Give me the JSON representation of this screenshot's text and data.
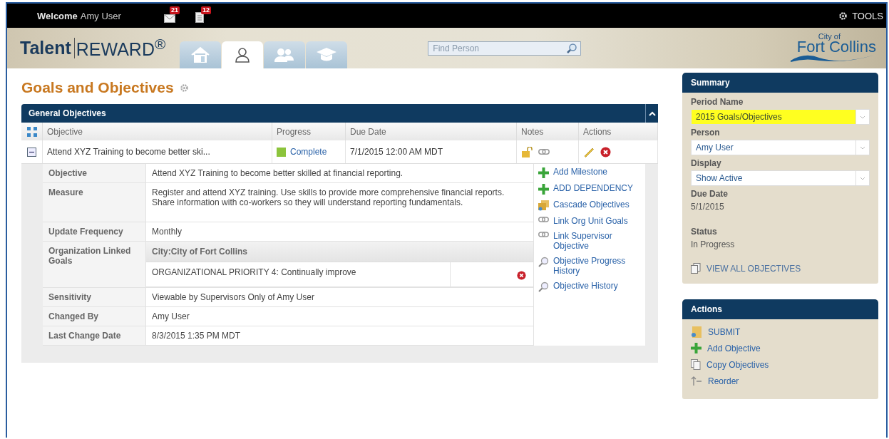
{
  "top_bar": {
    "welcome": "Welcome",
    "user_name": "Amy User",
    "notifications": [
      {
        "kind": "mail",
        "count": "21"
      },
      {
        "kind": "document",
        "count": "12"
      }
    ],
    "tools": "TOOLS"
  },
  "header": {
    "logo_left": "Talent",
    "logo_right": "REWARD$^{®}$",
    "tabs": [
      {
        "kind": "home",
        "selected": false
      },
      {
        "kind": "person",
        "selected": true
      },
      {
        "kind": "group",
        "selected": false
      },
      {
        "kind": "learning",
        "selected": false
      }
    ],
    "search": {
      "placeholder": "Find Person"
    },
    "city_logo_small": "City of",
    "city_logo_large": "Fort Collins"
  },
  "page_title": "Goals and Objectives",
  "objectives_panel": {
    "title": "General Objectives",
    "columns": [
      "Objective",
      "Progress",
      "Due Date",
      "Notes",
      "Actions"
    ],
    "rows": [
      {
        "objective": "Attend XYZ Training to become better ski...",
        "progress": {
          "label": "Complete",
          "color": "#8cc43c"
        },
        "due_date": "7/1/2015 12:00 AM MDT",
        "expanded": true,
        "details": [
          {
            "kind": "text",
            "label": "Objective",
            "value": "Attend XYZ Training to become better skilled at financial reporting."
          },
          {
            "kind": "text",
            "label": "Measure",
            "value": "Register and attend XYZ training.  Use skills to provide more comprehensive financial reports.  Share information with co-workers so they will understand reporting fundamentals."
          },
          {
            "kind": "text",
            "label": "Update Frequency",
            "value": "Monthly"
          },
          {
            "kind": "linked",
            "label": "Organization Linked Goals",
            "group": "City:City of Fort Collins",
            "goal": "ORGANIZATIONAL PRIORITY 4: Continually improve"
          },
          {
            "kind": "text",
            "label": "Sensitivity",
            "value": "Viewable by Supervisors Only of Amy User"
          },
          {
            "kind": "text",
            "label": "Changed By",
            "value": "Amy User"
          },
          {
            "kind": "text",
            "label": "Last Change Date",
            "value": "8/3/2015 1:35 PM MDT"
          }
        ],
        "links": [
          {
            "kind": "plus",
            "label": "Add Milestone"
          },
          {
            "kind": "plus",
            "label": "ADD DEPENDENCY"
          },
          {
            "kind": "folders",
            "label": "Cascade Objectives"
          },
          {
            "kind": "chain",
            "label": "Link Org Unit Goals"
          },
          {
            "kind": "chain",
            "label": "Link Supervisor Objective"
          },
          {
            "kind": "magnifier",
            "label": "Objective Progress History"
          },
          {
            "kind": "magnifier",
            "label": "Objective History"
          }
        ]
      }
    ]
  },
  "summary": {
    "title": "Summary",
    "selects": [
      {
        "label": "Period Name",
        "value": "2015 Goals/Objectives",
        "highlighted": true
      },
      {
        "label": "Person",
        "value": "Amy User",
        "highlighted": false
      },
      {
        "label": "Display",
        "value": "Show Active",
        "highlighted": false
      }
    ],
    "facts": [
      {
        "label": "Due Date",
        "value": "5/1/2015"
      },
      {
        "label": "Status",
        "value": "In Progress"
      }
    ],
    "view_all": "VIEW ALL OBJECTIVES"
  },
  "actions": {
    "title": "Actions",
    "items": [
      {
        "kind": "submit",
        "label": "SUBMIT"
      },
      {
        "kind": "plus",
        "label": "Add Objective"
      },
      {
        "kind": "copy",
        "label": "Copy Objectives"
      },
      {
        "kind": "reorder",
        "label": "Reorder"
      }
    ]
  }
}
